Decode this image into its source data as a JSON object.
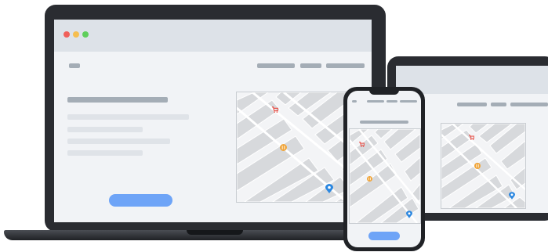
{
  "scene": {
    "devices": [
      "laptop",
      "tablet",
      "phone"
    ]
  },
  "laptop": {
    "browser_dots": [
      "#f0605a",
      "#f5be4f",
      "#5fcf5b"
    ],
    "cta_color": "#6ea4f7"
  },
  "map": {
    "icons": [
      "shopping-cart-icon",
      "restaurant-icon",
      "location-pin-icon"
    ],
    "colors": {
      "cart": "#e8574f",
      "restaurant": "#f0a53a",
      "pin": "#2b87e0"
    }
  }
}
